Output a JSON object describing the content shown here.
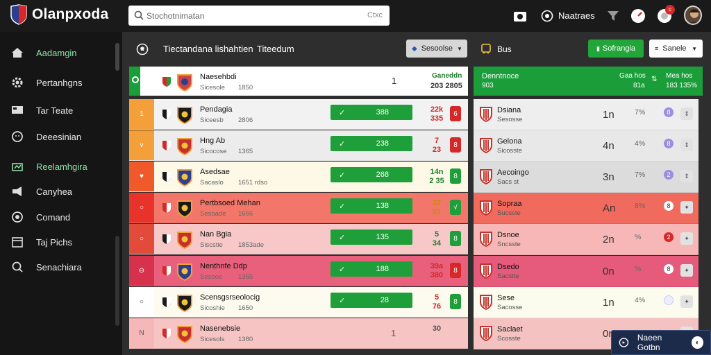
{
  "app": {
    "name": "Olanpxoda"
  },
  "search": {
    "placeholder": "Stochotnimatan",
    "hint": "Ctxc"
  },
  "topbar": {
    "user_label": "Naatraes",
    "notif_count": "c"
  },
  "sidebar": {
    "items": [
      {
        "label": "Aadamgin",
        "icon": "home-icon",
        "active": true
      },
      {
        "label": "Pertanhgns",
        "icon": "gear-icon",
        "active": false
      },
      {
        "label": "Tar Teate",
        "icon": "tv-icon",
        "active": false
      },
      {
        "label": "Deeesinian",
        "icon": "clock-icon",
        "active": false
      },
      {
        "label": "Reelamhgira",
        "icon": "chart-icon",
        "active": true
      },
      {
        "label": "Canyhea",
        "icon": "megaphone-icon",
        "active": false
      },
      {
        "label": "Comand",
        "icon": "target-icon",
        "active": false
      },
      {
        "label": "Taj Pichs",
        "icon": "calendar-icon",
        "active": false
      },
      {
        "label": "Senachiara",
        "icon": "search-icon",
        "active": false
      }
    ]
  },
  "subbar": {
    "title": "Tiectandana lishahtien",
    "title2": "Titeedum",
    "dropdown1": "Sesoolse",
    "label": "Bus",
    "green_button": "Sofrangia",
    "dropdown2": "Sanele"
  },
  "left_table": {
    "header": {
      "name": "Naesehbdi",
      "sub": "Sicesole",
      "meta": "1850",
      "center": "1",
      "right_top": "Ganeddn",
      "right_bottom": "203 2805"
    },
    "rows": [
      {
        "name": "Pendagia",
        "sub": "Siceesb",
        "meta": "2806",
        "pill": "388",
        "odds_top": "22k",
        "odds_bottom": "335",
        "odds_color": "#d62828",
        "box": "6",
        "box_color": "#d62828",
        "stripe": "#f3a03a",
        "mark": "1",
        "bg": "#f2f2f2"
      },
      {
        "name": "Hng Ab",
        "sub": "Sicocose",
        "meta": "1365",
        "pill": "238",
        "odds_top": "7",
        "odds_bottom": "23",
        "odds_color": "#d62828",
        "box": "8",
        "box_color": "#d62828",
        "stripe": "#f3a03a",
        "mark": "v",
        "bg": "#ececec"
      },
      {
        "name": "Asedsae",
        "sub": "Sacaslo",
        "meta": "1651 rdso",
        "pill": "268",
        "odds_top": "14n",
        "odds_bottom": "2 35",
        "odds_color": "#1e7f2e",
        "box": "8",
        "box_color": "#1e9f3a",
        "stripe": "#f05a2a",
        "mark": "♥",
        "bg": "#fdf9e6"
      },
      {
        "name": "Pertbsoed Mehan",
        "sub": "Sesoade",
        "meta": "1666",
        "pill": "138",
        "odds_top": "37",
        "odds_bottom": "81",
        "odds_color": "#c98a00",
        "box": "√",
        "box_color": "#1e9f3a",
        "stripe": "#e8332a",
        "mark": "○",
        "bg": "#f2776a"
      },
      {
        "name": "Nan Bgia",
        "sub": "Siscstie",
        "meta": "1853ade",
        "pill": "135",
        "odds_top": "5",
        "odds_bottom": "34",
        "odds_color": "#1e7f2e",
        "box": "8",
        "box_color": "#1e9f3a",
        "stripe": "#e24a3a",
        "mark": "○",
        "bg": "#f8c7c7"
      },
      {
        "name": "Nenthnfe  Ddp",
        "sub": "Sesooe",
        "meta": "1365",
        "pill": "188",
        "odds_top": "39a",
        "odds_bottom": "380",
        "odds_color": "#d62828",
        "box": "8",
        "box_color": "#d62828",
        "stripe": "#d8314c",
        "mark": "⊖",
        "bg": "#e8607c"
      },
      {
        "name": "Scensgsrseolocig",
        "sub": "Sicoshie",
        "meta": "1650",
        "pill": "28",
        "odds_top": "5",
        "odds_bottom": "76",
        "odds_color": "#d62828",
        "box": "8",
        "box_color": "#1e9f3a",
        "stripe": "#ffffff",
        "mark": "○",
        "bg": "#fdfbef"
      },
      {
        "name": "Nasenebsie",
        "sub": "Sicesols",
        "meta": "1380",
        "pill": "",
        "center": "1",
        "odds_top": "",
        "odds_bottom": "30",
        "odds_color": "#555",
        "box": "",
        "box_color": "transparent",
        "stripe": "#f5b7b7",
        "mark": "N",
        "bg": "#f7c4c4"
      }
    ]
  },
  "right_panel": {
    "header": {
      "name": "Denntnoce",
      "sub": "903",
      "c1_top": "Gaa hos",
      "c1_bottom": "81a",
      "c2_top": "Mea hos",
      "c2_bottom": "183 135%"
    },
    "rows": [
      {
        "name": "Dsiana",
        "sub": "Sesosse",
        "val": "1n",
        "pct": "7%",
        "badge": "8",
        "badge_color": "#9a8fe0",
        "bg": "#eeeeee"
      },
      {
        "name": "Gelona",
        "sub": "Sicosste",
        "val": "4n",
        "pct": "4%",
        "badge": "8",
        "badge_color": "#9a8fe0",
        "bg": "#e8e8e8"
      },
      {
        "name": "Aecoingo",
        "sub": "Sacs st",
        "val": "3n",
        "pct": "7%",
        "badge": "2",
        "badge_color": "#9a8fe0",
        "bg": "#dcdcdc"
      },
      {
        "name": "Sopraa",
        "sub": "Sucsste",
        "val": "An",
        "pct": "8%",
        "badge": "8",
        "badge_color": "#ffffff",
        "bg": "#f06a5e"
      },
      {
        "name": "Dsnoe",
        "sub": "Sncsste",
        "val": "2n",
        "pct": "%",
        "badge": "2",
        "badge_color": "#d62828",
        "bg": "#f7b7b7"
      },
      {
        "name": "Dsedo",
        "sub": "Sacstte",
        "val": "0n",
        "pct": "%",
        "badge": "8",
        "badge_color": "#ffffff",
        "bg": "#e65a7c"
      },
      {
        "name": "Sese",
        "sub": "Sacosse",
        "val": "1n",
        "pct": "4%",
        "badge": "",
        "badge_color": "#cce",
        "bg": "#fbfbee"
      },
      {
        "name": "Saclaet",
        "sub": "Scosste",
        "val": "0n",
        "pct": "",
        "badge": "",
        "badge_color": "transparent",
        "bg": "#f5c2c2"
      }
    ]
  },
  "chat": {
    "label": "Naeen Gotbn"
  },
  "colors": {
    "green": "#1e9f3a",
    "red": "#d62828",
    "dark": "#1a1a1a"
  }
}
